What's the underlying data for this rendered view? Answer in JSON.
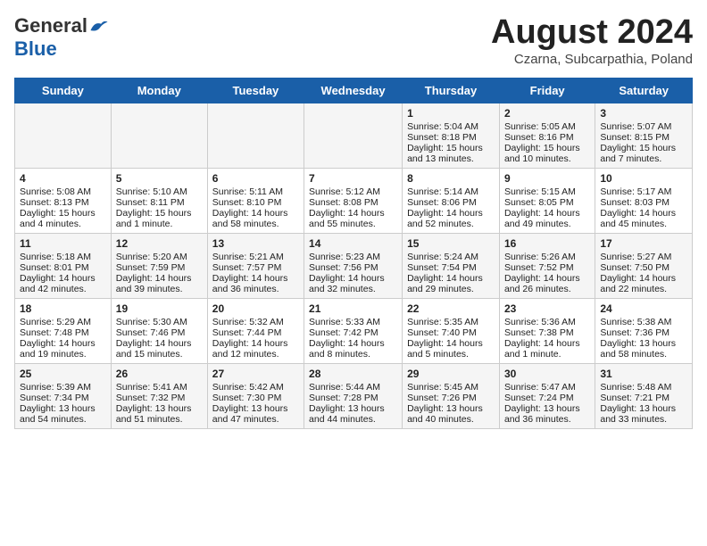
{
  "header": {
    "logo_general": "General",
    "logo_blue": "Blue",
    "month_year": "August 2024",
    "location": "Czarna, Subcarpathia, Poland"
  },
  "weekdays": [
    "Sunday",
    "Monday",
    "Tuesday",
    "Wednesday",
    "Thursday",
    "Friday",
    "Saturday"
  ],
  "weeks": [
    [
      {
        "day": "",
        "content": ""
      },
      {
        "day": "",
        "content": ""
      },
      {
        "day": "",
        "content": ""
      },
      {
        "day": "",
        "content": ""
      },
      {
        "day": "1",
        "content": "Sunrise: 5:04 AM\nSunset: 8:18 PM\nDaylight: 15 hours\nand 13 minutes."
      },
      {
        "day": "2",
        "content": "Sunrise: 5:05 AM\nSunset: 8:16 PM\nDaylight: 15 hours\nand 10 minutes."
      },
      {
        "day": "3",
        "content": "Sunrise: 5:07 AM\nSunset: 8:15 PM\nDaylight: 15 hours\nand 7 minutes."
      }
    ],
    [
      {
        "day": "4",
        "content": "Sunrise: 5:08 AM\nSunset: 8:13 PM\nDaylight: 15 hours\nand 4 minutes."
      },
      {
        "day": "5",
        "content": "Sunrise: 5:10 AM\nSunset: 8:11 PM\nDaylight: 15 hours\nand 1 minute."
      },
      {
        "day": "6",
        "content": "Sunrise: 5:11 AM\nSunset: 8:10 PM\nDaylight: 14 hours\nand 58 minutes."
      },
      {
        "day": "7",
        "content": "Sunrise: 5:12 AM\nSunset: 8:08 PM\nDaylight: 14 hours\nand 55 minutes."
      },
      {
        "day": "8",
        "content": "Sunrise: 5:14 AM\nSunset: 8:06 PM\nDaylight: 14 hours\nand 52 minutes."
      },
      {
        "day": "9",
        "content": "Sunrise: 5:15 AM\nSunset: 8:05 PM\nDaylight: 14 hours\nand 49 minutes."
      },
      {
        "day": "10",
        "content": "Sunrise: 5:17 AM\nSunset: 8:03 PM\nDaylight: 14 hours\nand 45 minutes."
      }
    ],
    [
      {
        "day": "11",
        "content": "Sunrise: 5:18 AM\nSunset: 8:01 PM\nDaylight: 14 hours\nand 42 minutes."
      },
      {
        "day": "12",
        "content": "Sunrise: 5:20 AM\nSunset: 7:59 PM\nDaylight: 14 hours\nand 39 minutes."
      },
      {
        "day": "13",
        "content": "Sunrise: 5:21 AM\nSunset: 7:57 PM\nDaylight: 14 hours\nand 36 minutes."
      },
      {
        "day": "14",
        "content": "Sunrise: 5:23 AM\nSunset: 7:56 PM\nDaylight: 14 hours\nand 32 minutes."
      },
      {
        "day": "15",
        "content": "Sunrise: 5:24 AM\nSunset: 7:54 PM\nDaylight: 14 hours\nand 29 minutes."
      },
      {
        "day": "16",
        "content": "Sunrise: 5:26 AM\nSunset: 7:52 PM\nDaylight: 14 hours\nand 26 minutes."
      },
      {
        "day": "17",
        "content": "Sunrise: 5:27 AM\nSunset: 7:50 PM\nDaylight: 14 hours\nand 22 minutes."
      }
    ],
    [
      {
        "day": "18",
        "content": "Sunrise: 5:29 AM\nSunset: 7:48 PM\nDaylight: 14 hours\nand 19 minutes."
      },
      {
        "day": "19",
        "content": "Sunrise: 5:30 AM\nSunset: 7:46 PM\nDaylight: 14 hours\nand 15 minutes."
      },
      {
        "day": "20",
        "content": "Sunrise: 5:32 AM\nSunset: 7:44 PM\nDaylight: 14 hours\nand 12 minutes."
      },
      {
        "day": "21",
        "content": "Sunrise: 5:33 AM\nSunset: 7:42 PM\nDaylight: 14 hours\nand 8 minutes."
      },
      {
        "day": "22",
        "content": "Sunrise: 5:35 AM\nSunset: 7:40 PM\nDaylight: 14 hours\nand 5 minutes."
      },
      {
        "day": "23",
        "content": "Sunrise: 5:36 AM\nSunset: 7:38 PM\nDaylight: 14 hours\nand 1 minute."
      },
      {
        "day": "24",
        "content": "Sunrise: 5:38 AM\nSunset: 7:36 PM\nDaylight: 13 hours\nand 58 minutes."
      }
    ],
    [
      {
        "day": "25",
        "content": "Sunrise: 5:39 AM\nSunset: 7:34 PM\nDaylight: 13 hours\nand 54 minutes."
      },
      {
        "day": "26",
        "content": "Sunrise: 5:41 AM\nSunset: 7:32 PM\nDaylight: 13 hours\nand 51 minutes."
      },
      {
        "day": "27",
        "content": "Sunrise: 5:42 AM\nSunset: 7:30 PM\nDaylight: 13 hours\nand 47 minutes."
      },
      {
        "day": "28",
        "content": "Sunrise: 5:44 AM\nSunset: 7:28 PM\nDaylight: 13 hours\nand 44 minutes."
      },
      {
        "day": "29",
        "content": "Sunrise: 5:45 AM\nSunset: 7:26 PM\nDaylight: 13 hours\nand 40 minutes."
      },
      {
        "day": "30",
        "content": "Sunrise: 5:47 AM\nSunset: 7:24 PM\nDaylight: 13 hours\nand 36 minutes."
      },
      {
        "day": "31",
        "content": "Sunrise: 5:48 AM\nSunset: 7:21 PM\nDaylight: 13 hours\nand 33 minutes."
      }
    ]
  ]
}
